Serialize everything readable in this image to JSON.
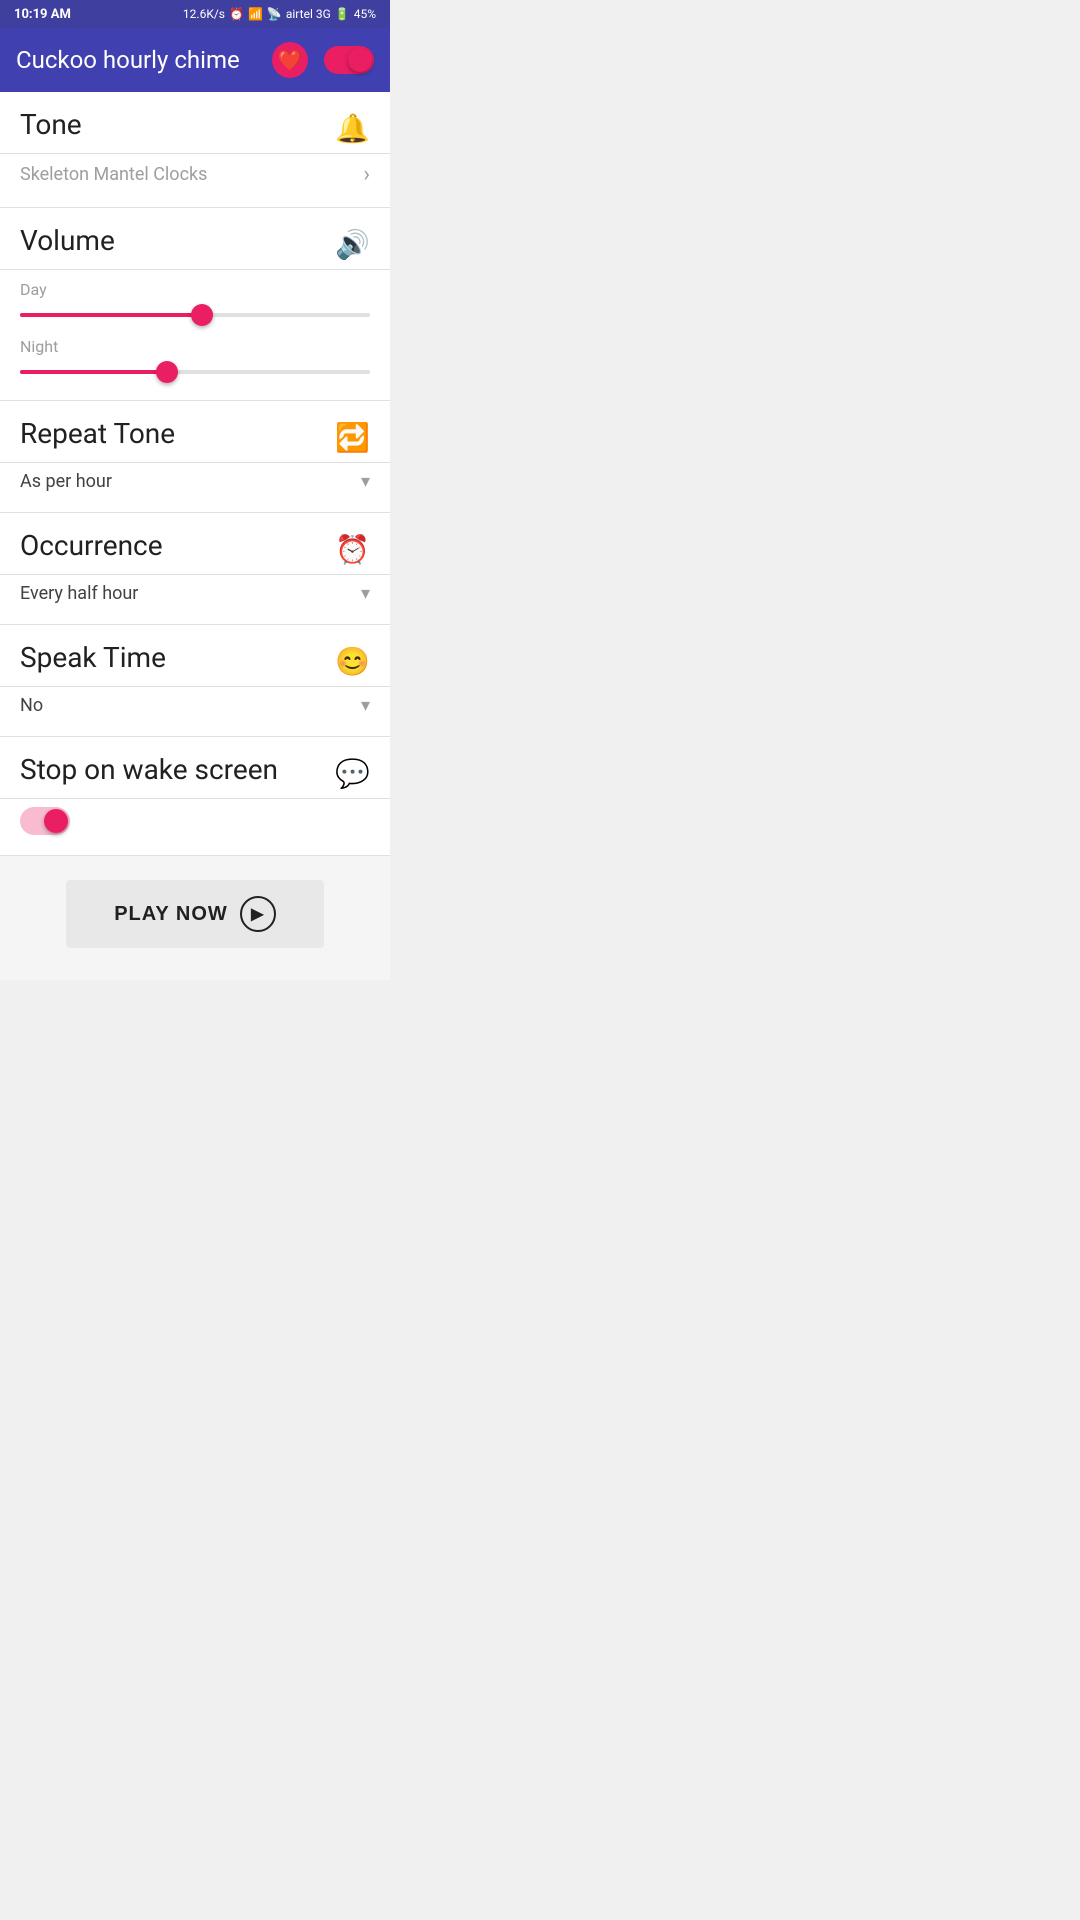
{
  "statusBar": {
    "time": "10:19 AM",
    "speed": "12.6K/s",
    "carrier": "airtel 3G",
    "battery": "45%"
  },
  "appBar": {
    "title": "Cuckoo hourly chime",
    "heartIcon": "heart-icon",
    "toggleOn": true
  },
  "sections": {
    "tone": {
      "title": "Tone",
      "value": "Skeleton Mantel Clocks",
      "icon": "bell-icon"
    },
    "volume": {
      "title": "Volume",
      "icon": "volume-icon",
      "dayLabel": "Day",
      "dayValue": 52,
      "nightLabel": "Night",
      "nightValue": 42
    },
    "repeatTone": {
      "title": "Repeat Tone",
      "icon": "repeat-icon",
      "value": "As per hour"
    },
    "occurrence": {
      "title": "Occurrence",
      "icon": "alarm-icon",
      "value": "Every half hour"
    },
    "speakTime": {
      "title": "Speak Time",
      "icon": "face-icon",
      "value": "No"
    },
    "stopOnWake": {
      "title": "Stop on wake screen",
      "icon": "chat-icon",
      "toggleOn": true
    }
  },
  "playButton": {
    "label": "PLAY NOW"
  }
}
